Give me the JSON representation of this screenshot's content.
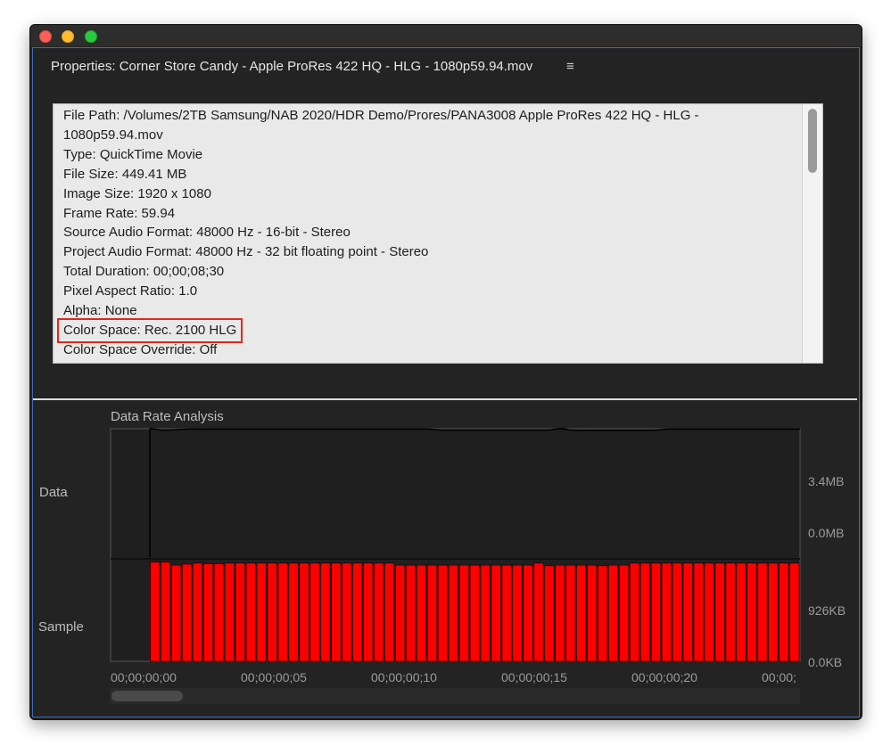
{
  "window": {
    "panel_title": "Properties: Corner Store Candy - Apple ProRes 422 HQ - HLG - 1080p59.94.mov",
    "menu_icon": "hamburger-menu-icon"
  },
  "properties": {
    "file_path": "File Path: /Volumes/2TB Samsung/NAB 2020/HDR Demo/Prores/PANA3008 Apple ProRes 422 HQ - HLG - 1080p59.94.mov",
    "type": "Type: QuickTime Movie",
    "file_size": "File Size: 449.41 MB",
    "image_size": "Image Size: 1920 x 1080",
    "frame_rate": "Frame Rate: 59.94",
    "source_audio": "Source Audio Format: 48000 Hz - 16-bit - Stereo",
    "project_audio": "Project Audio Format: 48000 Hz - 32 bit floating point - Stereo",
    "total_duration": "Total Duration: 00;00;08;30",
    "pixel_aspect": "Pixel Aspect Ratio: 1.0",
    "alpha": "Alpha: None",
    "color_space": "Color Space: Rec. 2100 HLG",
    "color_space_override": "Color Space Override: Off",
    "highlight_color": "#e0281c"
  },
  "analysis": {
    "title": "Data Rate Analysis",
    "data_label": "Data",
    "sample_label": "Sample"
  },
  "chart_data": {
    "type": "bar",
    "title": "Data Rate Analysis",
    "data_axis": {
      "ticks": [
        "3.4MB",
        "0.0MB"
      ]
    },
    "sample_axis": {
      "ticks": [
        "926KB",
        "0.0KB"
      ],
      "ylim": [
        0,
        1050
      ]
    },
    "x_ticks": [
      "00;00;00;00",
      "00;00;00;05",
      "00;00;00;10",
      "00;00;00;15",
      "00;00;00;20",
      "00;00;"
    ],
    "data_line": [
      6.06,
      5.97,
      6.0,
      6.03,
      6.03,
      6.03,
      6.03,
      6.03,
      6.03,
      6.03,
      6.03,
      6.03,
      6.03,
      6.03,
      6.03,
      6.03,
      6.03,
      6.03,
      6.03,
      6.03,
      6.03,
      6.03,
      5.98,
      5.98,
      5.98,
      5.98,
      5.98,
      5.98,
      5.98,
      5.98,
      5.98,
      6.06,
      5.96,
      5.97,
      5.97,
      5.97,
      5.97,
      5.97,
      5.97,
      6.03,
      6.03,
      6.03,
      6.03,
      6.03,
      6.03,
      6.03,
      6.03,
      6.03,
      6.03,
      6.03
    ],
    "sample_values": [
      1016,
      1016,
      985,
      995,
      1006,
      1000,
      1000,
      1006,
      1006,
      1006,
      1006,
      1006,
      1006,
      1006,
      1006,
      1006,
      1006,
      1006,
      1006,
      1006,
      1006,
      1006,
      1006,
      985,
      985,
      985,
      985,
      985,
      985,
      985,
      985,
      985,
      985,
      985,
      985,
      985,
      1006,
      979,
      985,
      985,
      985,
      985,
      979,
      985,
      985,
      1006,
      1006,
      1006,
      1006,
      1006,
      1006,
      1006,
      1006,
      1006,
      1006,
      1006,
      1006,
      1006,
      1006,
      1006,
      1006
    ],
    "bar_color": "#ff0000"
  }
}
